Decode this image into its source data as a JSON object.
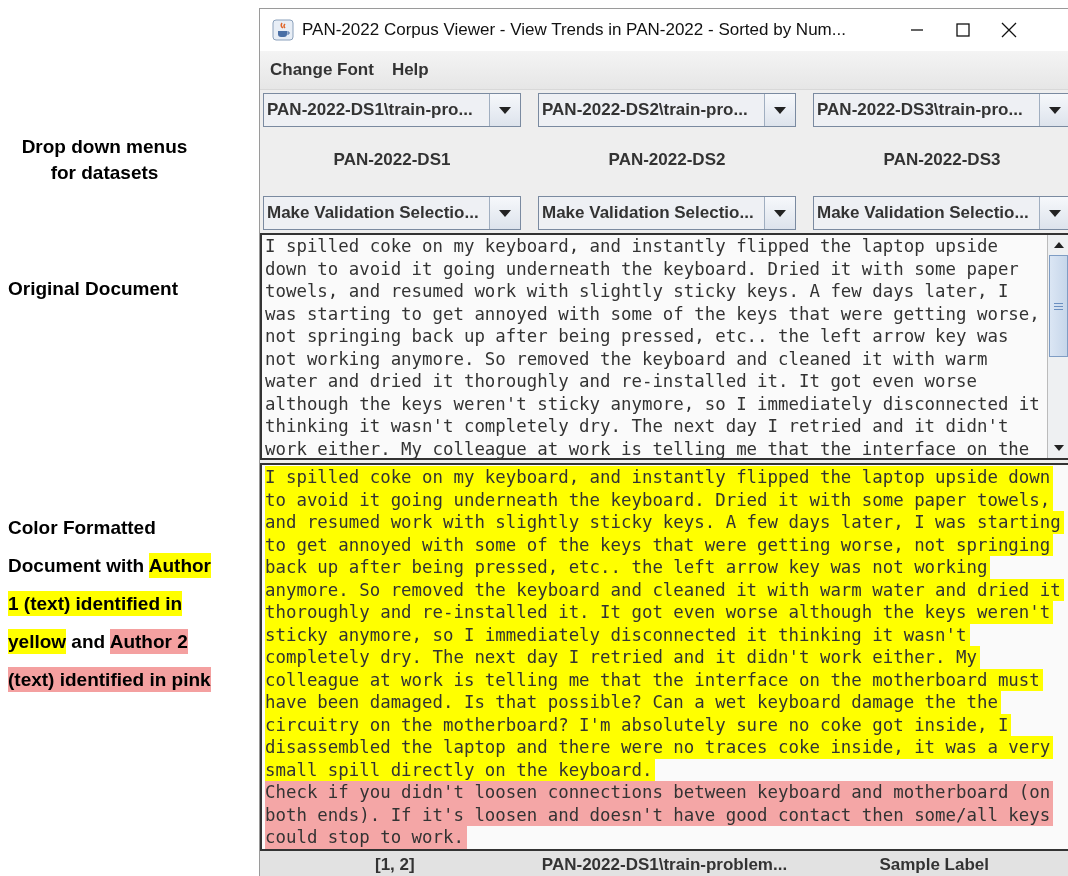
{
  "annotations": {
    "dropdowns_note": "Drop down menus for datasets",
    "original_note": "Original Document",
    "color_note": [
      [
        {
          "text": "Color Formatted"
        }
      ],
      [
        {
          "text": "Document with "
        },
        {
          "text": "Author",
          "color": "#ffff00"
        }
      ],
      [
        {
          "text": "1 (text) identified in",
          "color": "#ffff00"
        }
      ],
      [
        {
          "text": "yellow",
          "color": "#ffff00"
        },
        {
          "text": " and "
        },
        {
          "text": "Author 2",
          "color": "#f4a0a0"
        }
      ],
      [
        {
          "text": "(text) identified in pink",
          "color": "#f4a0a0"
        }
      ]
    ]
  },
  "window": {
    "title": "PAN-2022 Corpus Viewer - View Trends in PAN-2022 - Sorted by Num..."
  },
  "menu": [
    "Change Font",
    "Help"
  ],
  "datasets": [
    {
      "file": "PAN-2022-DS1\\train-pro...",
      "label": "PAN-2022-DS1",
      "validation": "Make Validation Selectio..."
    },
    {
      "file": "PAN-2022-DS2\\train-pro...",
      "label": "PAN-2022-DS2",
      "validation": "Make Validation Selectio..."
    },
    {
      "file": "PAN-2022-DS3\\train-pro...",
      "label": "PAN-2022-DS3",
      "validation": "Make Validation Selectio..."
    }
  ],
  "original_document": {
    "lines": [
      "I spilled coke on my keyboard, and instantly flipped the laptop upside",
      "down to avoid it going underneath the keyboard. Dried it with some paper",
      "towels, and resumed work with slightly sticky keys. A few days later, I",
      "was starting to get annoyed with some of the keys that were getting worse,",
      "not springing back up after being pressed, etc.. the left arrow key was",
      "not working anymore. So removed the keyboard and cleaned it with warm",
      "water and dried it thoroughly and re-installed it. It got even worse",
      "although the keys weren't sticky anymore, so I immediately disconnected it",
      "thinking it wasn't completely dry. The next day I retried and it didn't",
      "work either. My colleague at work is telling me that the interface on the"
    ]
  },
  "formatted_document": {
    "segments": [
      {
        "color": "#ffff00",
        "lines": [
          "I spilled coke on my keyboard, and instantly flipped the laptop upside down",
          "to avoid it going underneath the keyboard. Dried it with some paper towels,",
          "and resumed work with slightly sticky keys. A few days later, I was starting",
          "to get annoyed with some of the keys that were getting worse, not springing",
          "back up after being pressed, etc.. the left arrow key was not working",
          "anymore. So removed the keyboard and cleaned it with warm water and dried it",
          "thoroughly and re-installed it. It got even worse although the keys weren't",
          "sticky anymore, so I immediately disconnected it thinking it wasn't",
          "completely dry. The next day I retried and it didn't work either. My",
          "colleague at work is telling me that the interface on the motherboard must",
          "have been damaged. Is that possible? Can a wet keyboard damage the the",
          "circuitry on the motherboard? I'm absolutely sure no coke got inside, I",
          "disassembled the laptop and there were no traces coke inside, it was a very",
          "small spill directly on the keyboard."
        ]
      },
      {
        "color": "#f4a6a6",
        "lines": [
          "Check if you didn't loosen connections between keyboard and motherboard (on",
          "both ends). If it's loosen and doesn't have good contact then some/all keys",
          "could stop to work."
        ]
      }
    ]
  },
  "status_bar": [
    "[1, 2]",
    "PAN-2022-DS1\\train-problem...",
    "Sample Label"
  ]
}
